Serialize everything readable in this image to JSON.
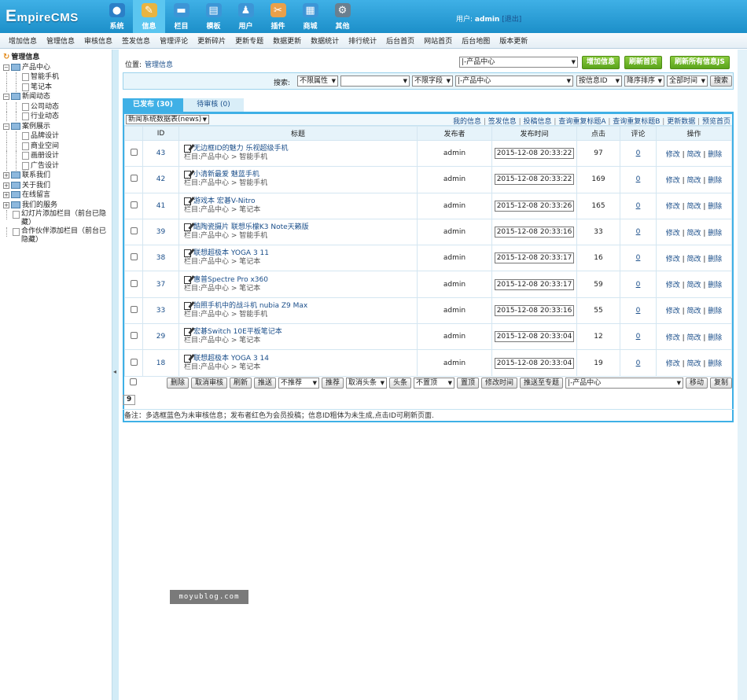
{
  "header": {
    "logo": {
      "big": "E",
      "rest": "mpireCMS"
    },
    "nav": [
      {
        "label": "系统",
        "icon": "globe-icon",
        "glyph": "●",
        "color": "#2b7fc7",
        "active": false
      },
      {
        "label": "信息",
        "icon": "document-edit-icon",
        "glyph": "✎",
        "color": "#e9b441",
        "active": true
      },
      {
        "label": "栏目",
        "icon": "folder-icon",
        "glyph": "▬",
        "color": "#3c95d6",
        "active": false
      },
      {
        "label": "模板",
        "icon": "template-window-icon",
        "glyph": "▤",
        "color": "#3c95d6",
        "active": false
      },
      {
        "label": "用户",
        "icon": "user-icon",
        "glyph": "♟",
        "color": "#3c95d6",
        "active": false
      },
      {
        "label": "插件",
        "icon": "tools-icon",
        "glyph": "✂",
        "color": "#e9a04a",
        "active": false
      },
      {
        "label": "商城",
        "icon": "shop-icon",
        "glyph": "▦",
        "color": "#3c95d6",
        "active": false
      },
      {
        "label": "其他",
        "icon": "gear-icon",
        "glyph": "⚙",
        "color": "#6a7f8f",
        "active": false
      }
    ],
    "user_prefix": "用户:",
    "username": "admin",
    "logout": "[退出]"
  },
  "subnav": [
    "增加信息",
    "管理信息",
    "审核信息",
    "签发信息",
    "管理评论",
    "更新碎片",
    "更新专题",
    "数据更新",
    "数据统计",
    "排行统计",
    "后台首页",
    "网站首页",
    "后台地图",
    "版本更新"
  ],
  "sidebar": {
    "title": "管理信息",
    "items": [
      {
        "label": "产品中心",
        "type": "folder",
        "toggle": "−",
        "depth": 0
      },
      {
        "label": "智能手机",
        "type": "page",
        "depth": 1
      },
      {
        "label": "笔记本",
        "type": "page",
        "depth": 1
      },
      {
        "label": "新闻动态",
        "type": "folder",
        "toggle": "−",
        "depth": 0
      },
      {
        "label": "公司动态",
        "type": "page",
        "depth": 1
      },
      {
        "label": "行业动态",
        "type": "page",
        "depth": 1
      },
      {
        "label": "案例展示",
        "type": "folder",
        "toggle": "−",
        "depth": 0
      },
      {
        "label": "品牌设计",
        "type": "page",
        "depth": 1
      },
      {
        "label": "商业空间",
        "type": "page",
        "depth": 1
      },
      {
        "label": "画册设计",
        "type": "page",
        "depth": 1
      },
      {
        "label": "广告设计",
        "type": "page",
        "depth": 1
      },
      {
        "label": "联系我们",
        "type": "folder",
        "toggle": "+",
        "depth": 0
      },
      {
        "label": "关于我们",
        "type": "folder",
        "toggle": "+",
        "depth": 0
      },
      {
        "label": "在线留言",
        "type": "folder",
        "toggle": "+",
        "depth": 0
      },
      {
        "label": "我们的服务",
        "type": "folder",
        "toggle": "+",
        "depth": 0
      },
      {
        "label": "幻灯片添加栏目（前台已隐藏）",
        "type": "page",
        "depth": 0
      },
      {
        "label": "合作伙伴添加栏目（前台已隐藏）",
        "type": "page",
        "depth": 0
      }
    ]
  },
  "location": {
    "label": "位置:",
    "link": "管理信息"
  },
  "top_controls": {
    "column_select": "|-产品中心",
    "add_button": "增加信息",
    "refresh_home": "刷新首页",
    "refresh_js": "刷新所有信息JS"
  },
  "search": {
    "label": "搜索:",
    "attr_select": "不限属性",
    "keyword_value": "",
    "field_select": "不限字段",
    "column_select": "|-产品中心",
    "order_select": "按信息ID",
    "direction_select": "降序排序",
    "time_select": "全部时间",
    "button": "搜索"
  },
  "tabs": {
    "published": "已发布 (30)",
    "pending": "待审核 (0)"
  },
  "list": {
    "table_select": "新闻系统数据表(news)",
    "actions": [
      "我的信息",
      "签发信息",
      "投稿信息",
      "查询重复标题A",
      "查询重复标题B",
      "更新数据",
      "预览首页"
    ],
    "columns": {
      "id": "ID",
      "title": "标题",
      "publisher": "发布者",
      "time": "发布时间",
      "hits": "点击",
      "comments": "评论",
      "ops": "操作"
    },
    "ops": {
      "edit": "修改",
      "simple_edit": "简改",
      "delete": "删除"
    },
    "cat_prefix": "栏目:",
    "rows": [
      {
        "id": "43",
        "title": "无边框ID的魅力 乐视超级手机",
        "cat": "产品中心 > 智能手机",
        "publisher": "admin",
        "time": "2015-12-08 20:33:22",
        "hits": "97",
        "comments": "0"
      },
      {
        "id": "42",
        "title": "小清新最爱 魅蓝手机",
        "cat": "产品中心 > 智能手机",
        "publisher": "admin",
        "time": "2015-12-08 20:33:22",
        "hits": "169",
        "comments": "0"
      },
      {
        "id": "41",
        "title": "游戏本 宏碁V-Nitro",
        "cat": "产品中心 > 笔记本",
        "publisher": "admin",
        "time": "2015-12-08 20:33:26",
        "hits": "165",
        "comments": "0"
      },
      {
        "id": "39",
        "title": "酷陶瓷摄片 联想乐檬K3 Note天籁版",
        "cat": "产品中心 > 智能手机",
        "publisher": "admin",
        "time": "2015-12-08 20:33:16",
        "hits": "33",
        "comments": "0"
      },
      {
        "id": "38",
        "title": "联想超极本 YOGA 3 11",
        "cat": "产品中心 > 笔记本",
        "publisher": "admin",
        "time": "2015-12-08 20:33:17",
        "hits": "16",
        "comments": "0"
      },
      {
        "id": "37",
        "title": "惠普Spectre Pro x360",
        "cat": "产品中心 > 笔记本",
        "publisher": "admin",
        "time": "2015-12-08 20:33:17",
        "hits": "59",
        "comments": "0"
      },
      {
        "id": "33",
        "title": "拍照手机中的战斗机 nubia Z9 Max",
        "cat": "产品中心 > 智能手机",
        "publisher": "admin",
        "time": "2015-12-08 20:33:16",
        "hits": "55",
        "comments": "0"
      },
      {
        "id": "29",
        "title": "宏碁Switch 10E平板笔记本",
        "cat": "产品中心 > 笔记本",
        "publisher": "admin",
        "time": "2015-12-08 20:33:04",
        "hits": "12",
        "comments": "0"
      },
      {
        "id": "18",
        "title": "联想超极本 YOGA 3 14",
        "cat": "产品中心 > 笔记本",
        "publisher": "admin",
        "time": "2015-12-08 20:33:04",
        "hits": "19",
        "comments": "0"
      }
    ],
    "bottom": {
      "delete": "删除",
      "unaudit": "取消审核",
      "refresh": "刷新",
      "push": "推送",
      "recommend_select": "不推荐",
      "recommend": "推荐",
      "unheadline_select": "取消头条",
      "headline": "头条",
      "untop_select": "不置顶",
      "top": "置顶",
      "edit_time": "修改时间",
      "push_special": "推送至专题",
      "move_select": "|-产品中心",
      "move": "移动",
      "copy": "复制"
    }
  },
  "pager": "9",
  "note": "备注：多选框蓝色为未审核信息；发布者红色为会员投稿；信息ID粗体为未生成,点击ID可刷新页面.",
  "watermark": "moyublog.com"
}
